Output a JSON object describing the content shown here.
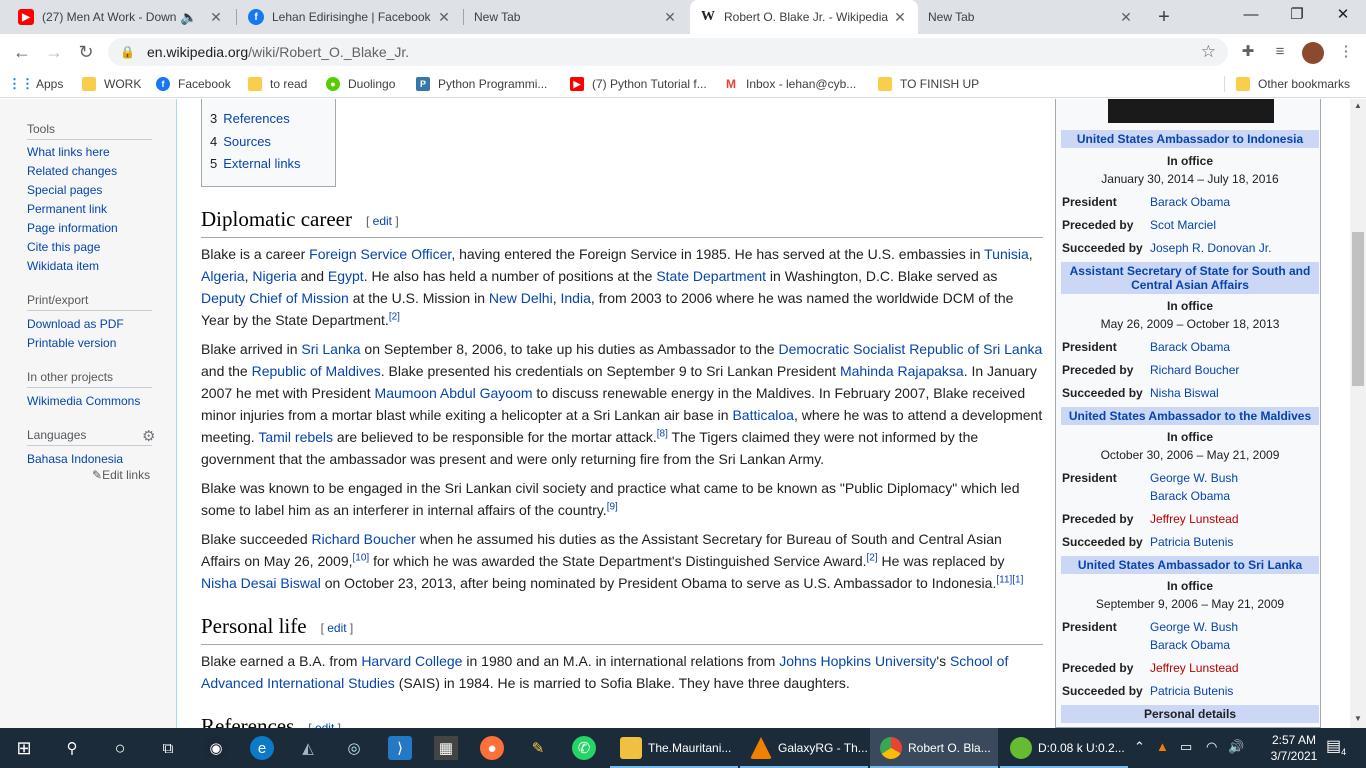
{
  "browser": {
    "tabs": [
      {
        "title": "(27) Men At Work - Down",
        "icon": "youtube-icon",
        "active": false
      },
      {
        "title": "Lehan Edirisinghe | Facebook",
        "icon": "facebook-icon",
        "active": false
      },
      {
        "title": "New Tab",
        "icon": "",
        "active": false
      },
      {
        "title": "Robert O. Blake Jr. - Wikipedia",
        "icon": "wikipedia-icon",
        "active": true
      },
      {
        "title": "New Tab",
        "icon": "",
        "active": false
      }
    ],
    "new_tab": "+",
    "window": {
      "minimize": "—",
      "maximize": "❐",
      "close": "✕"
    },
    "url_host": "en.wikipedia.org",
    "url_path": "/wiki/Robert_O._Blake_Jr.",
    "bookmarks": [
      {
        "label": "Apps",
        "icon": "apps-icon"
      },
      {
        "label": "WORK",
        "icon": "folder-icon"
      },
      {
        "label": "Facebook",
        "icon": "facebook-icon"
      },
      {
        "label": "to read",
        "icon": "folder-icon"
      },
      {
        "label": "Duolingo",
        "icon": "duolingo-icon"
      },
      {
        "label": "Python Programmi...",
        "icon": "python-icon"
      },
      {
        "label": "(7) Python Tutorial f...",
        "icon": "youtube-icon"
      },
      {
        "label": "Inbox - lehan@cyb...",
        "icon": "gmail-icon"
      },
      {
        "label": "TO FINISH UP",
        "icon": "folder-icon"
      },
      {
        "label": "Other bookmarks",
        "icon": "folder-icon"
      }
    ],
    "colors": {
      "tabbar": "#dee1e6",
      "link": "#0645ad",
      "redlink": "#ba0000"
    }
  },
  "sidebar": {
    "tools_heading": "Tools",
    "tools": [
      "What links here",
      "Related changes",
      "Special pages",
      "Permanent link",
      "Page information",
      "Cite this page",
      "Wikidata item"
    ],
    "print_heading": "Print/export",
    "print": [
      "Download as PDF",
      "Printable version"
    ],
    "projects_heading": "In other projects",
    "projects": [
      "Wikimedia Commons"
    ],
    "languages_heading": "Languages",
    "languages": [
      "Bahasa Indonesia"
    ],
    "edit_links": "Edit links"
  },
  "toc": [
    {
      "num": "3",
      "label": "References"
    },
    {
      "num": "4",
      "label": "Sources"
    },
    {
      "num": "5",
      "label": "External links"
    }
  ],
  "article": {
    "edit_label": "edit",
    "diplomatic_heading": "Diplomatic career",
    "personal_heading": "Personal life",
    "references_heading": "References",
    "p1": {
      "a": "Blake is a career ",
      "l1": "Foreign Service Officer",
      "b": ", having entered the Foreign Service in 1985. He has served at the U.S. embassies in ",
      "l2": "Tunisia",
      "c": ", ",
      "l3": "Algeria",
      "d": ", ",
      "l4": "Nigeria",
      "e": " and ",
      "l5": "Egypt",
      "f": ". He also has held a number of positions at the ",
      "l6": "State Department",
      "g": " in Washington, D.C. Blake served as ",
      "l7": "Deputy Chief of Mission",
      "h": " at the U.S. Mission in ",
      "l8": "New Delhi",
      "i": ", ",
      "l9": "India",
      "j": ", from 2003 to 2006 where he was named the worldwide DCM of the Year by the State Department.",
      "r1": "[2]"
    },
    "p2": {
      "a": "Blake arrived in ",
      "l1": "Sri Lanka",
      "b": " on September 8, 2006, to take up his duties as Ambassador to the ",
      "l2": "Democratic Socialist Republic of Sri Lanka",
      "c": " and the ",
      "l3": "Republic of Maldives",
      "d": ". Blake presented his credentials on September 9 to Sri Lankan President ",
      "l4": "Mahinda Rajapaksa",
      "e": ". In January 2007 he met with President ",
      "l5": "Maumoon Abdul Gayoom",
      "f": " to discuss renewable energy in the Maldives. In February 2007, Blake received minor injuries from a mortar blast while exiting a helicopter at a Sri Lankan air base in ",
      "l6": "Batticaloa",
      "g": ", where he was to attend a development meeting. ",
      "l7": "Tamil rebels",
      "h": " are believed to be responsible for the mortar attack.",
      "r1": "[8]",
      "i": " The Tigers claimed they were not informed by the government that the ambassador was present and were only returning fire from the Sri Lankan Army."
    },
    "p3": {
      "a": "Blake was known to be engaged in the Sri Lankan civil society and practice what came to be known as \"Public Diplomacy\" which led some to label him as an interferer in internal affairs of the country.",
      "r1": "[9]"
    },
    "p4": {
      "a": "Blake succeeded ",
      "l1": "Richard Boucher",
      "b": " when he assumed his duties as the Assistant Secretary for Bureau of South and Central Asian Affairs on May 26, 2009,",
      "r1": "[10]",
      "c": " for which he was awarded the State Department's Distinguished Service Award.",
      "r2": "[2]",
      "d": " He was replaced by ",
      "l2": "Nisha Desai Biswal",
      "e": " on October 23, 2013, after being nominated by President Obama to serve as U.S. Ambassador to Indonesia.",
      "r3": "[11][1]"
    },
    "p5": {
      "a": "Blake earned a B.A. from ",
      "l1": "Harvard College",
      "b": " in 1980 and an M.A. in international relations from ",
      "l2": "Johns Hopkins University",
      "c": "'s ",
      "l3": "School of Advanced International Studies",
      "d": " (SAIS) in 1984. He is married to Sofia Blake. They have three daughters."
    }
  },
  "infobox": {
    "in_office": "In office",
    "president_label": "President",
    "preceded_label": "Preceded by",
    "succeeded_label": "Succeeded by",
    "personal_details": "Personal details",
    "offices": [
      {
        "title": "United States Ambassador to Indonesia",
        "term": "January 30, 2014 – July 18, 2016",
        "presidents": [
          "Barack Obama"
        ],
        "preceded": "Scot Marciel",
        "succeeded": "Joseph R. Donovan Jr."
      },
      {
        "title": "Assistant Secretary of State for South and Central Asian Affairs",
        "term": "May 26, 2009 – October 18, 2013",
        "presidents": [
          "Barack Obama"
        ],
        "preceded": "Richard Boucher",
        "succeeded": "Nisha Biswal"
      },
      {
        "title": "United States Ambassador to the Maldives",
        "term": "October 30, 2006 – May 21, 2009",
        "presidents": [
          "George W. Bush",
          "Barack Obama"
        ],
        "preceded": "Jeffrey Lunstead",
        "succeeded": "Patricia Butenis"
      },
      {
        "title": "United States Ambassador to Sri Lanka",
        "term": "September 9, 2006 – May 21, 2009",
        "presidents": [
          "George W. Bush",
          "Barack Obama"
        ],
        "preceded": "Jeffrey Lunstead",
        "succeeded": "Patricia Butenis"
      }
    ]
  },
  "taskbar": {
    "apps": [
      {
        "label": "The.Mauritani...",
        "icon": "folder-icon",
        "color": "#f0c040"
      },
      {
        "label": "GalaxyRG - Th...",
        "icon": "vlc-icon",
        "color": "#f08000"
      },
      {
        "label": "Robert O. Bla...",
        "icon": "chrome-icon",
        "color": "#4caf50"
      },
      {
        "label": "D:0.08 k U:0.2...",
        "icon": "utorrent-icon",
        "color": "#66bb33"
      }
    ],
    "time": "2:57 AM",
    "date": "3/7/2021",
    "notifications": "4"
  }
}
